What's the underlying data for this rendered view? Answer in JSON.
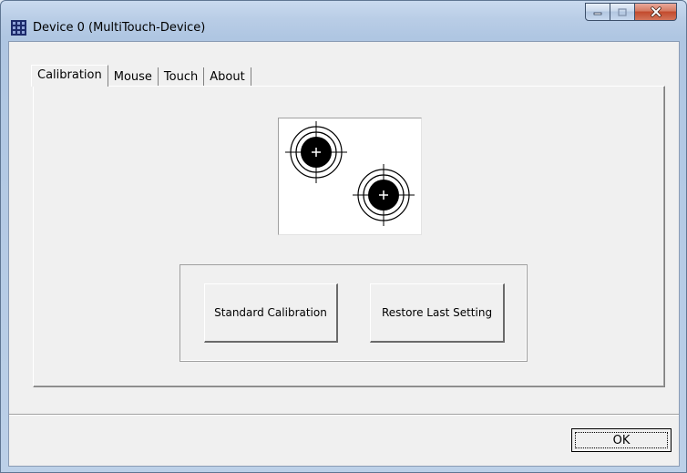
{
  "window": {
    "title": "Device 0 (MultiTouch-Device)",
    "icons": {
      "app": "grid-app-icon",
      "minimize": "minimize-icon",
      "maximize": "maximize-icon",
      "close": "close-icon"
    }
  },
  "tabs": [
    {
      "label": "Calibration",
      "active": true
    },
    {
      "label": "Mouse",
      "active": false
    },
    {
      "label": "Touch",
      "active": false
    },
    {
      "label": "About",
      "active": false
    }
  ],
  "calibration": {
    "image": "calibration-targets-icon",
    "standard_button": "Standard Calibration",
    "restore_button": "Restore Last Setting"
  },
  "footer": {
    "ok_label": "OK"
  },
  "colors": {
    "accent_close": "#c24a2c",
    "dialog_bg": "#f0f0f0",
    "frame": "#b9cde6"
  }
}
